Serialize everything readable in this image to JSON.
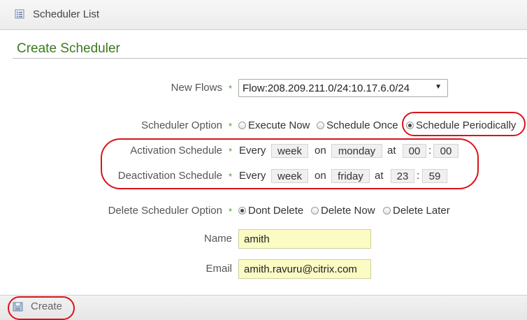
{
  "header": {
    "title": "Scheduler List",
    "icon": "list-icon"
  },
  "form": {
    "heading": "Create Scheduler",
    "required_mark": "*",
    "new_flows": {
      "label": "New Flows",
      "selected": "Flow:208.209.211.0/24:10.17.6.0/24"
    },
    "scheduler_option": {
      "label": "Scheduler Option",
      "options": [
        "Execute Now",
        "Schedule Once",
        "Schedule Periodically"
      ],
      "selected": "Schedule Periodically"
    },
    "activation": {
      "label": "Activation Schedule",
      "every": "Every",
      "period": "week",
      "on": "on",
      "day": "monday",
      "at": "at",
      "hour": "00",
      "sep": ":",
      "minute": "00"
    },
    "deactivation": {
      "label": "Deactivation Schedule",
      "every": "Every",
      "period": "week",
      "on": "on",
      "day": "friday",
      "at": "at",
      "hour": "23",
      "sep": ":",
      "minute": "59"
    },
    "delete_option": {
      "label": "Delete Scheduler Option",
      "options": [
        "Dont Delete",
        "Delete Now",
        "Delete Later"
      ],
      "selected": "Dont Delete"
    },
    "name": {
      "label": "Name",
      "value": "amith"
    },
    "email": {
      "label": "Email",
      "value": "amith.ravuru@citrix.com"
    }
  },
  "footer": {
    "create_label": "Create",
    "icon": "save-icon"
  },
  "colors": {
    "heading": "#3a7a1f",
    "highlight_oval": "#d9131b",
    "field_bg": "#fbfbc4"
  }
}
